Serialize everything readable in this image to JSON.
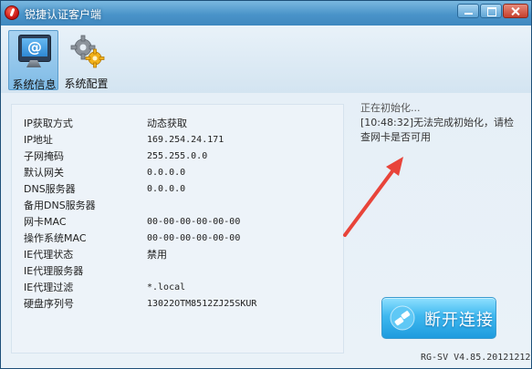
{
  "window": {
    "title": "锐捷认证客户端"
  },
  "toolbar": {
    "items": [
      {
        "label": "系统信息",
        "icon": "monitor-at-icon",
        "active": true
      },
      {
        "label": "系统配置",
        "icon": "gears-icon",
        "active": false
      }
    ]
  },
  "info": {
    "rows": [
      {
        "label": "IP获取方式",
        "value": "动态获取"
      },
      {
        "label": "IP地址",
        "value": "169.254.24.171"
      },
      {
        "label": "子网掩码",
        "value": "255.255.0.0"
      },
      {
        "label": "默认网关",
        "value": "0.0.0.0"
      },
      {
        "label": "DNS服务器",
        "value": "0.0.0.0"
      },
      {
        "label": "备用DNS服务器",
        "value": ""
      },
      {
        "label": "网卡MAC",
        "value": "00-00-00-00-00-00"
      },
      {
        "label": "操作系统MAC",
        "value": "00-00-00-00-00-00"
      },
      {
        "label": "IE代理状态",
        "value": "禁用"
      },
      {
        "label": "IE代理服务器",
        "value": ""
      },
      {
        "label": "IE代理过滤",
        "value": "*.local"
      },
      {
        "label": "硬盘序列号",
        "value": "13022OTM8512ZJ25SKUR"
      }
    ]
  },
  "status": {
    "line1": "正在初始化...",
    "line2": "[10:48:32]无法完成初始化，请检",
    "line3": "查网卡是否可用"
  },
  "connect": {
    "label": "断开连接",
    "icon": "plug-icon"
  },
  "version": "RG-SV V4.85.20121212",
  "colors": {
    "titlebar": "#4a94c9",
    "button": "#3fb8ef",
    "arrow": "#e8443a"
  }
}
